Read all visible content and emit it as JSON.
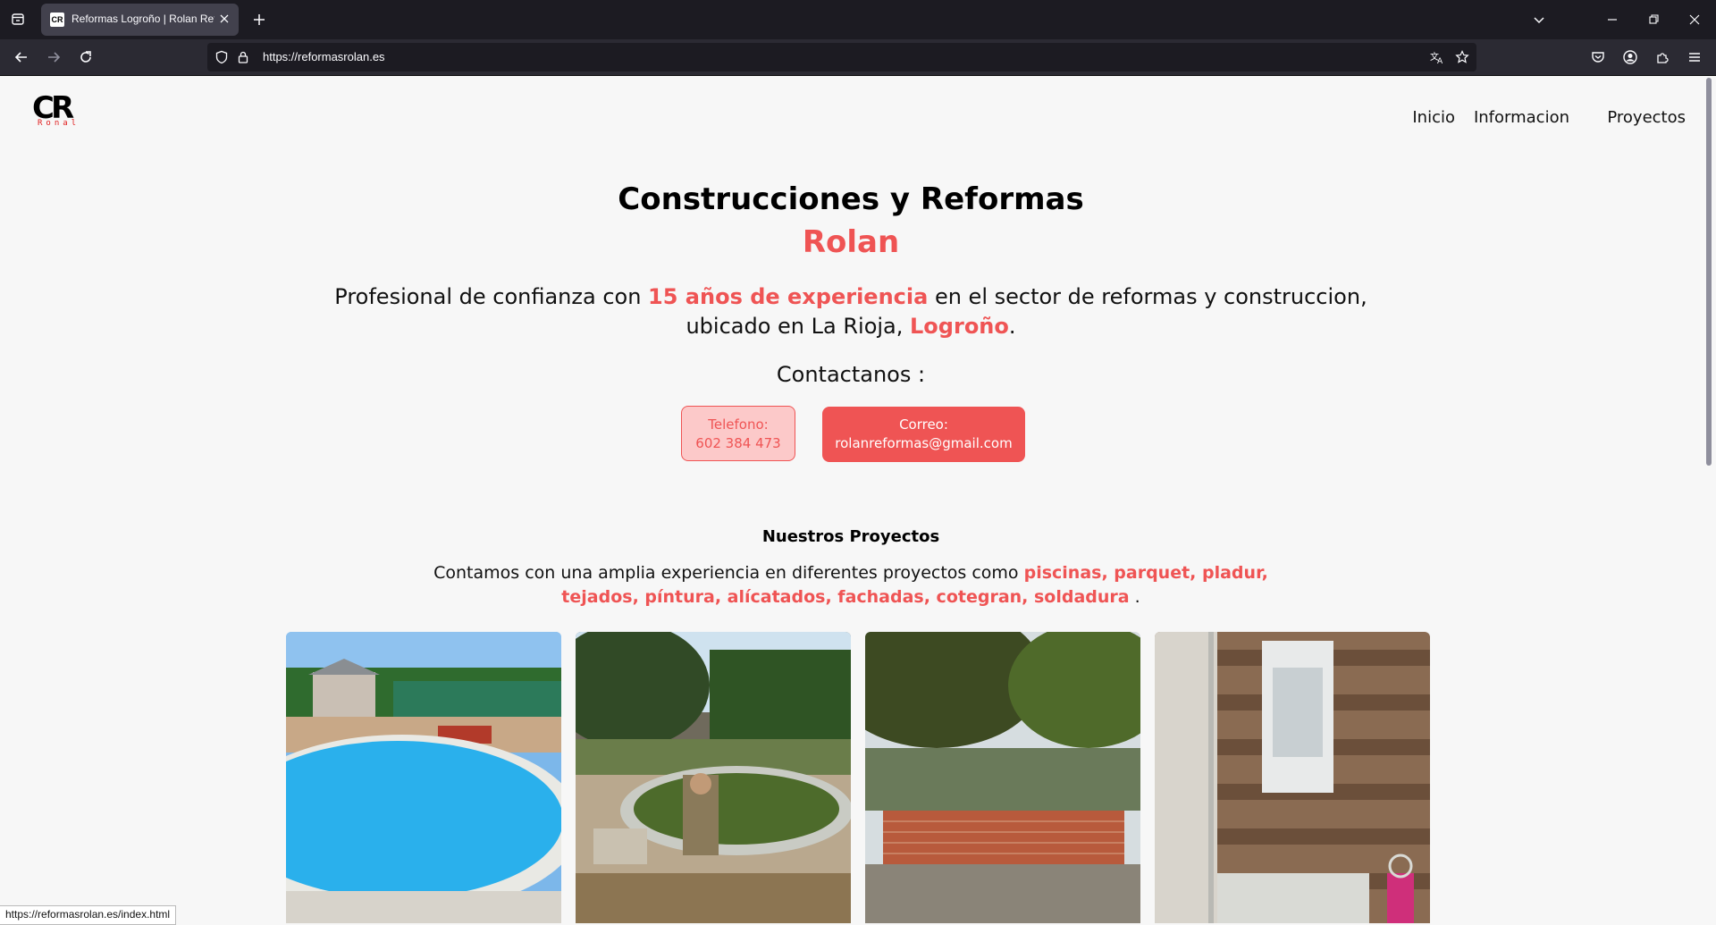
{
  "browser": {
    "tab_title": "Reformas Logroño | Rolan Refo",
    "favicon_text": "CR",
    "url": "https://reformasrolan.es",
    "status_url": "https://reformasrolan.es/index.html"
  },
  "site": {
    "logo_main": "CR",
    "logo_sub": "Ronal",
    "nav": [
      "Inicio",
      "Informacion",
      "Proyectos"
    ]
  },
  "hero": {
    "title": "Construcciones y Reformas",
    "subtitle": "Rolan",
    "desc_part1": "Profesional de confianza con ",
    "desc_highlight1": "15 años de experiencia",
    "desc_part2": " en el sector de reformas y construccion, ubicado en La Rioja, ",
    "desc_highlight2": "Logroño",
    "desc_part3": ".",
    "contact_title": "Contactanos :",
    "phone_label": "Telefono:",
    "phone_value": "602 384 473",
    "mail_label": "Correo:",
    "mail_value": "rolanreformas@gmail.com"
  },
  "projects": {
    "title": "Nuestros Proyectos",
    "desc_part1": "Contamos con una amplia experiencia en diferentes proyectos como ",
    "desc_highlight": "piscinas, parquet, pladur, tejados, píntura, alícatados, fachadas, cotegran, soldadura",
    "desc_part2": " .",
    "photos": [
      "pool-photo",
      "pool-construction-photo",
      "brick-wall-photo",
      "bathroom-photo"
    ]
  },
  "colors": {
    "accent": "#ef5454",
    "accent_light": "#fcc9c9",
    "chrome_dark": "#1c1b22",
    "chrome_toolbar": "#2b2a33"
  },
  "icons": [
    "tab-list-icon",
    "close-icon",
    "plus-icon",
    "chevron-down-icon",
    "minimize-icon",
    "restore-icon",
    "back-icon",
    "forward-icon",
    "reload-icon",
    "shield-icon",
    "lock-icon",
    "translate-icon",
    "star-icon",
    "pocket-icon",
    "account-icon",
    "extensions-icon",
    "menu-icon"
  ]
}
